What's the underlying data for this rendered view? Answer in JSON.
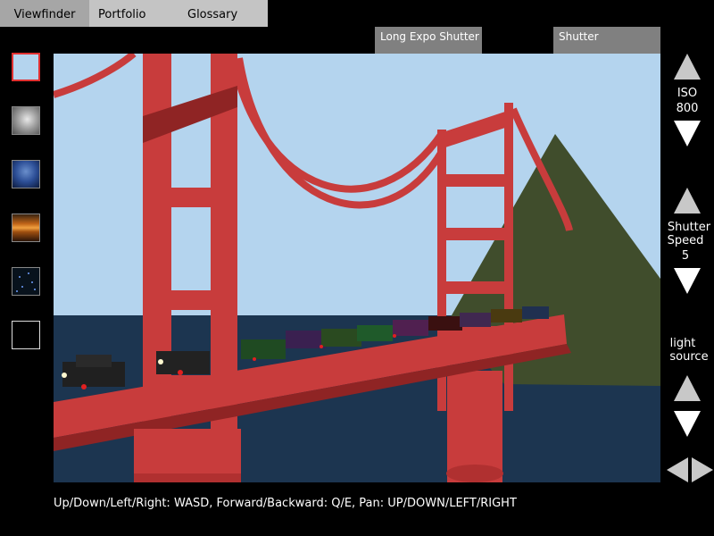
{
  "tabs": [
    "Viewfinder",
    "Portfolio",
    "Glossary"
  ],
  "mode_buttons": {
    "long_expo": "Long Expo Shutter",
    "shutter": "Shutter"
  },
  "iso": {
    "label": "ISO",
    "value": "800"
  },
  "shutter_speed": {
    "label_line1": "Shutter",
    "label_line2": "Speed",
    "value": "5"
  },
  "light_source": {
    "line1": "light",
    "line2": "source"
  },
  "hint": "Up/Down/Left/Right: WASD, Forward/Backward: Q/E, Pan: UP/DOWN/LEFT/RIGHT",
  "colors": {
    "sky": "#b4d4ee",
    "water": "#1c3550",
    "bridge": "#c83c3c",
    "hill": "#404d2c",
    "selected_border": "#e03030"
  },
  "sky_presets": [
    "clear-blue",
    "overcast",
    "deep-blue",
    "sunset",
    "night-stars",
    "dark"
  ]
}
